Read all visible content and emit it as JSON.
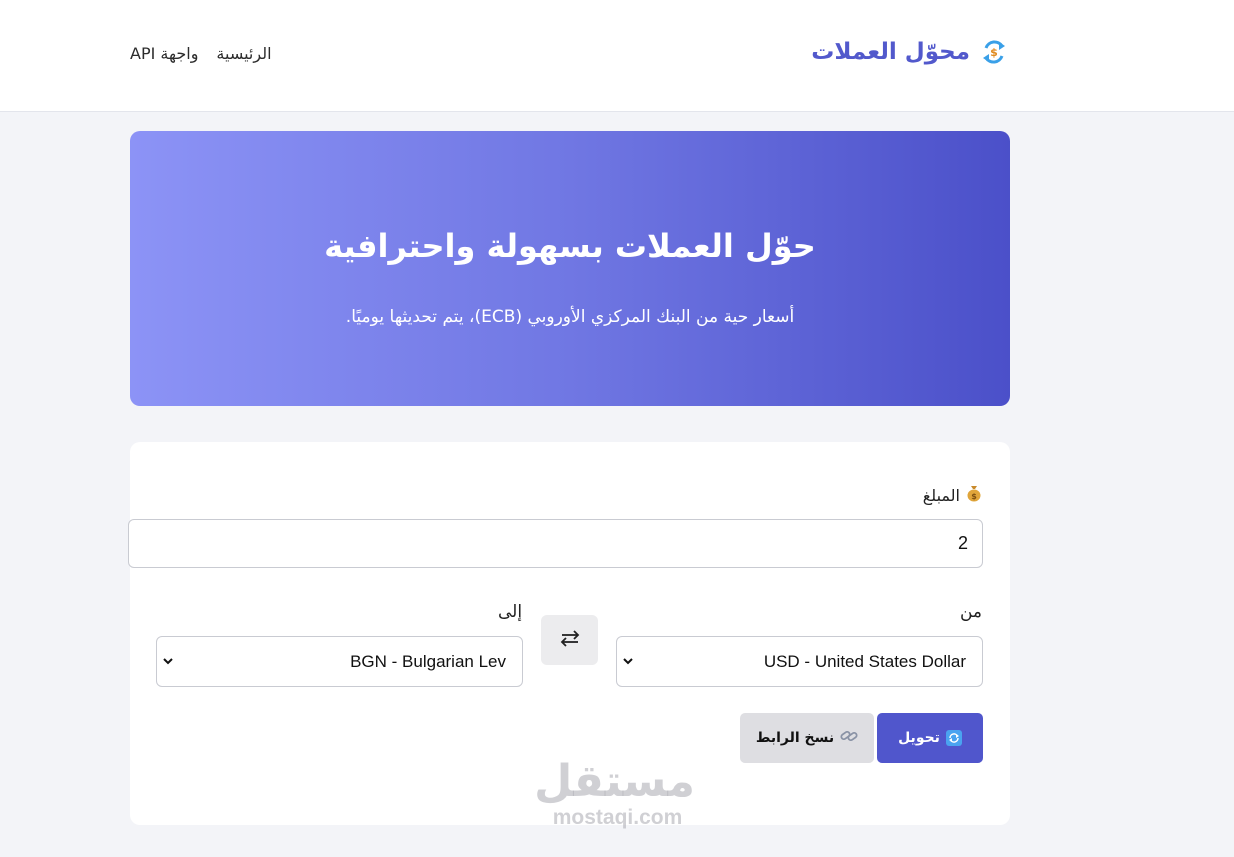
{
  "header": {
    "brand_title": "محوّل العملات",
    "brand_icon": "currency-exchange-icon",
    "nav": [
      {
        "label": "الرئيسية"
      },
      {
        "label": "واجهة API"
      }
    ]
  },
  "hero": {
    "title": "حوّل العملات بسهولة واحترافية",
    "subtitle": "أسعار حية من البنك المركزي الأوروبي (ECB)، يتم تحديثها يوميًا."
  },
  "form": {
    "amount_label": "المبلغ",
    "amount_icon": "money-bag-icon",
    "amount_value": "2",
    "from_label": "من",
    "to_label": "إلى",
    "from_value": "USD - United States Dollar",
    "to_value": "BGN - Bulgarian Lev",
    "swap_icon": "swap-arrows-icon",
    "convert_label": "تحويل",
    "convert_icon": "refresh-icon",
    "copy_label": "نسخ الرابط",
    "copy_icon": "link-icon"
  },
  "watermark": {
    "arabic": "مستقل",
    "latin": "mostaqi.com"
  },
  "colors": {
    "brand": "#5259cc",
    "hero_start": "#8c93f6",
    "hero_end": "#4b50c9",
    "primary_button": "#5056cc",
    "secondary_button": "#dedee2",
    "page_background": "#f3f4f8"
  }
}
